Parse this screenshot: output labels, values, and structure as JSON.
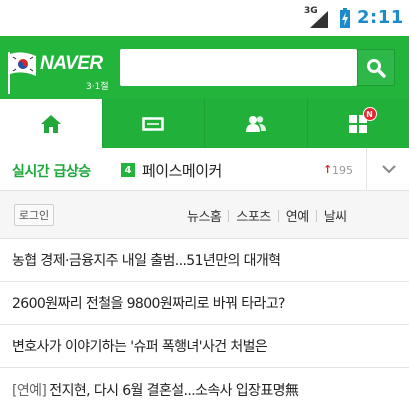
{
  "status_bar": {
    "network": "3G",
    "time": "2:11",
    "time_color": "#1a8ccc"
  },
  "header": {
    "logo_text": "NAVER",
    "logo_sub": "3·1절",
    "brand_color": "#22b43b",
    "search_placeholder": "",
    "search_value": ""
  },
  "nav": {
    "tabs": [
      {
        "icon": "home-icon",
        "active": true
      },
      {
        "icon": "rectangle-icon",
        "active": false
      },
      {
        "icon": "people-icon",
        "active": false
      },
      {
        "icon": "grid-icon",
        "active": false,
        "badge": "N"
      }
    ]
  },
  "trend": {
    "label": "실시간 급상승",
    "rank": "4",
    "keyword": "페이스메이커",
    "arrow": "↑",
    "count": "195",
    "up_color": "#e2262c"
  },
  "subrow": {
    "login_label": "로그인",
    "links": [
      "뉴스홈",
      "스포츠",
      "연예",
      "날씨"
    ]
  },
  "news": [
    {
      "tag": "",
      "title": "농협 경제·금융지주 내일 출범...51년만의 대개혁"
    },
    {
      "tag": "",
      "title": "2600원짜리 전철을 9800원짜리로 바꿔 타라고?"
    },
    {
      "tag": "",
      "title": "변호사가 이야기하는 '슈퍼 폭행녀'사건 처벌은"
    },
    {
      "tag": "[연예]",
      "title": "전지현, 다시 6월 결혼설...소속사 입장표명無"
    }
  ]
}
